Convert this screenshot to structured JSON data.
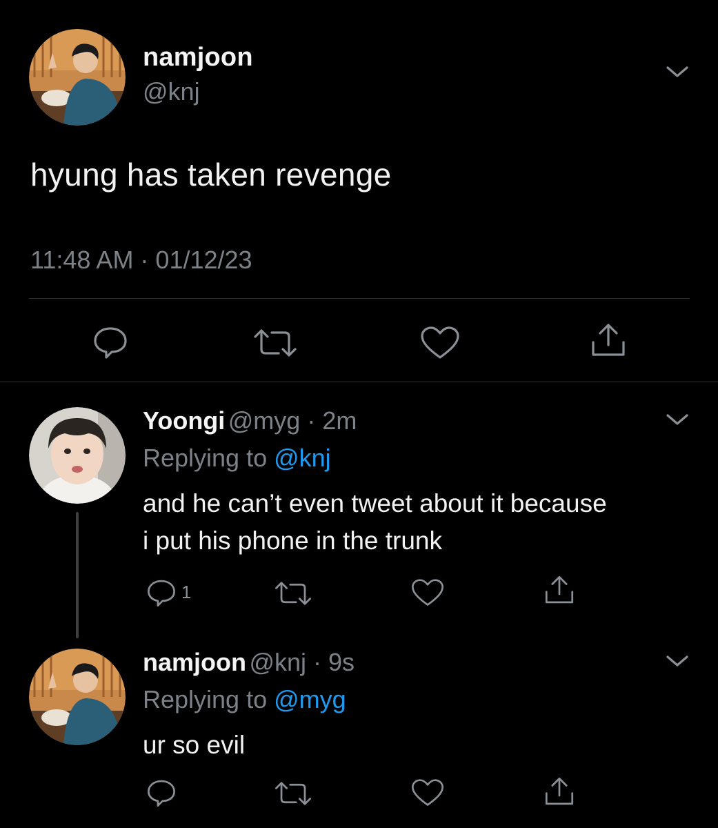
{
  "main_tweet": {
    "display_name": "namjoon",
    "handle": "@knj",
    "text": "hyung has taken revenge",
    "timestamp": "11:48 AM · 01/12/23",
    "avatar": "namjoon-avatar",
    "actions": [
      "reply-icon",
      "retweet-icon",
      "like-icon",
      "share-icon"
    ]
  },
  "replies": [
    {
      "display_name": "Yoongi",
      "meta": "@myg · 2m",
      "replying_prefix": "Replying to ",
      "replying_handle": "@knj",
      "text_line1": "and he can’t even tweet about it because",
      "text_line2": "i put his phone in the trunk",
      "reply_count": "1",
      "avatar": "yoongi-avatar"
    },
    {
      "display_name": "namjoon",
      "meta": "@knj · 9s",
      "replying_prefix": "Replying to ",
      "replying_handle": "@myg",
      "text_line1": "ur so evil",
      "avatar": "namjoon-avatar"
    }
  ],
  "colors": {
    "background": "#000000",
    "primary_text": "#f2f2f2",
    "secondary_text": "#7d8288",
    "link": "#1d9bf0",
    "divider": "#2f3336"
  }
}
